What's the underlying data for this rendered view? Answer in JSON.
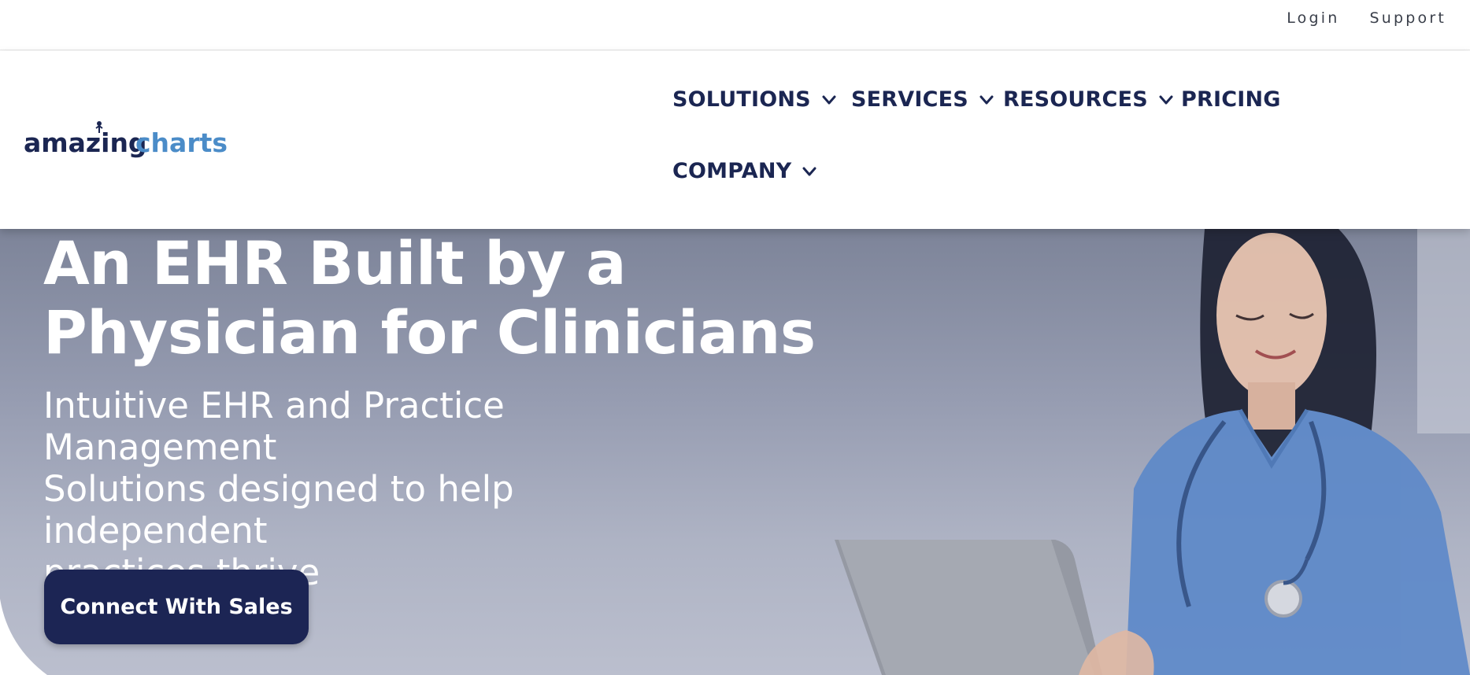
{
  "utility": {
    "login": "Login",
    "support": "Support"
  },
  "brand": {
    "logo_part1": "amazing",
    "logo_part2": "charts",
    "color_dark": "#1b2652",
    "color_blue": "#4b8cc8"
  },
  "nav": {
    "items": [
      {
        "label": "SOLUTIONS",
        "has_dropdown": true
      },
      {
        "label": "SERVICES",
        "has_dropdown": true
      },
      {
        "label": "RESOURCES",
        "has_dropdown": true
      },
      {
        "label": "PRICING",
        "has_dropdown": false
      },
      {
        "label": "COMPANY",
        "has_dropdown": true
      }
    ],
    "dropdown_icon": "chevron-down-icon"
  },
  "hero": {
    "title_line1": "An EHR Built by a",
    "title_line2": "Physician for Clinicians",
    "subtitle_line1": "Intuitive EHR and Practice Management",
    "subtitle_line2": "Solutions designed to help independent",
    "subtitle_line3": "practices thrive",
    "cta_label": "Connect With Sales",
    "cta_color": "#1c2554"
  }
}
